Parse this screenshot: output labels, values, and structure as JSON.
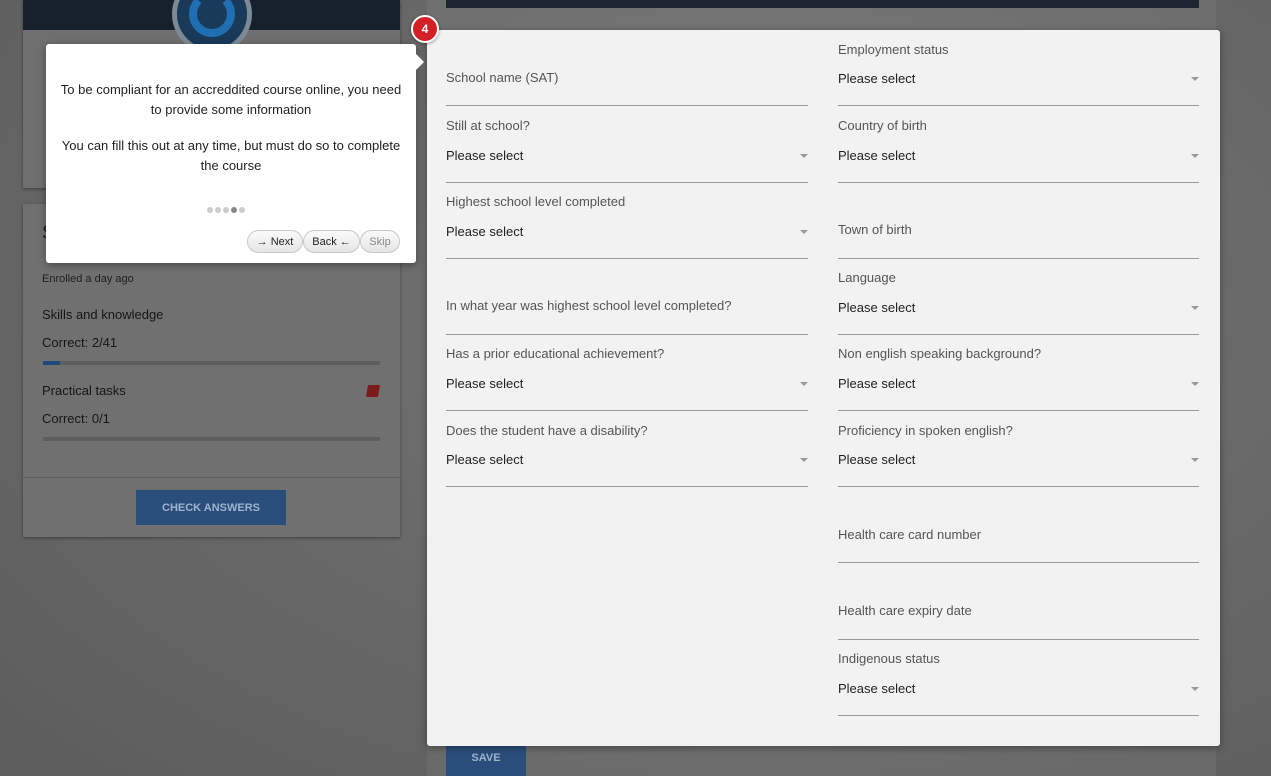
{
  "left_card": {
    "heading_letter": "S",
    "enrolled_text": "Enrolled a day ago",
    "sections": [
      {
        "title": "Skills and knowledge",
        "correct_text": "Correct: 2/41",
        "progress_fraction": 0.049
      },
      {
        "title": "Practical tasks",
        "correct_text": "Correct: 0/1",
        "progress_fraction": 0.0
      }
    ],
    "book_icon": "book-icon",
    "check_answers_label": "CHECK ANSWERS"
  },
  "save_label": "SAVE",
  "form": {
    "left_column": [
      {
        "label": "School name (SAT)",
        "value": "",
        "type": "text"
      },
      {
        "label": "Still at school?",
        "value": "Please select",
        "type": "select"
      },
      {
        "label": "Highest school level completed",
        "value": "Please select",
        "type": "select"
      },
      {
        "label": "In what year was highest school level completed?",
        "value": "",
        "type": "text"
      },
      {
        "label": "Has a prior educational achievement?",
        "value": "Please select",
        "type": "select"
      },
      {
        "label": "Does the student have a disability?",
        "value": "Please select",
        "type": "select"
      }
    ],
    "right_column": [
      {
        "label": "Employment status",
        "value": "Please select",
        "type": "select"
      },
      {
        "label": "Country of birth",
        "value": "Please select",
        "type": "select"
      },
      {
        "label": "Town of birth",
        "value": "",
        "type": "text"
      },
      {
        "label": "Language",
        "value": "Please select",
        "type": "select"
      },
      {
        "label": "Non english speaking background?",
        "value": "Please select",
        "type": "select"
      },
      {
        "label": "Proficiency in spoken english?",
        "value": "Please select",
        "type": "select"
      },
      {
        "label": "Health care card number",
        "value": "",
        "type": "text"
      },
      {
        "label": "Health care expiry date",
        "value": "",
        "type": "text"
      },
      {
        "label": "Indigenous status",
        "value": "Please select",
        "type": "select"
      }
    ]
  },
  "tour": {
    "step_number": "4",
    "paragraph1": "To be compliant for an accreddited course online, you need to provide some information",
    "paragraph2": "You can fill this out at any time, but must do so to complete the course",
    "total_steps": 5,
    "current_step": 4,
    "next_label": "→ Next",
    "back_label": "Back ←",
    "skip_label": "Skip"
  },
  "colors": {
    "accent_blue": "#2a4e7c",
    "badge_red": "#d51f26",
    "overlay_gray": "#6e6e6e"
  }
}
